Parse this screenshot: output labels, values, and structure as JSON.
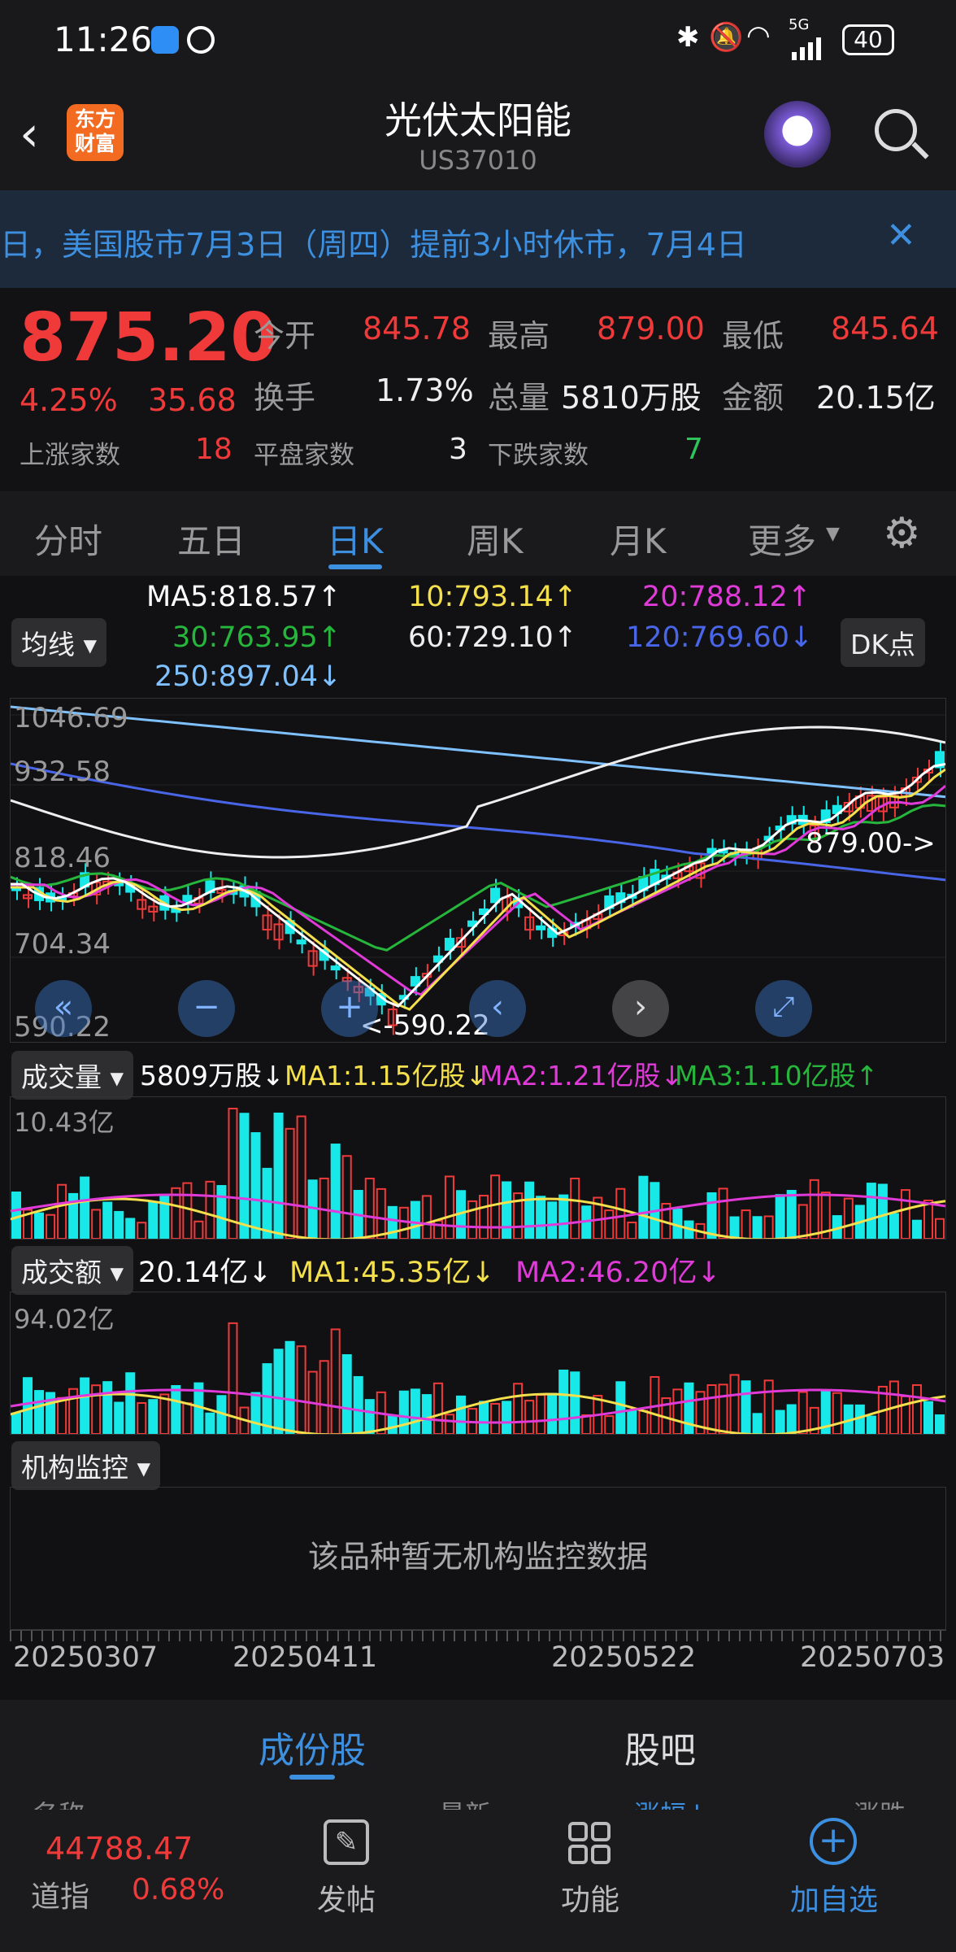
{
  "status": {
    "time": "11:26",
    "battery": "40",
    "net": "5G"
  },
  "header": {
    "title": "光伏太阳能",
    "code": "US37010",
    "logo": "东方财富",
    "logo_lines": [
      "东方",
      "财富"
    ]
  },
  "notice": {
    "text": "日，美国股市7月3日（周四）提前3小时休市，7月4日"
  },
  "quote": {
    "price": "875.20",
    "pct": "4.25%",
    "chg": "35.68",
    "open_label": "今开",
    "open": "845.78",
    "high_label": "最高",
    "high": "879.00",
    "low_label": "最低",
    "low": "845.64",
    "turnover_label": "换手",
    "turnover": "1.73%",
    "vol_label": "总量",
    "vol": "5810万股",
    "amt_label": "金额",
    "amt": "20.15亿",
    "up_label": "上涨家数",
    "up": "18",
    "flat_label": "平盘家数",
    "flat": "3",
    "down_label": "下跌家数",
    "down": "7"
  },
  "tabs": [
    "分时",
    "五日",
    "日K",
    "周K",
    "月K",
    "更多"
  ],
  "ma": {
    "btn": "均线",
    "ma5": "MA5:818.57↑",
    "ma10": "10:793.14↑",
    "ma20": "20:788.12↑",
    "ma30": "30:763.95↑",
    "ma60": "60:729.10↑",
    "ma120": "120:769.60↓",
    "ma250": "250:897.04↓",
    "dk": "DK点"
  },
  "price_axis": [
    "1046.69",
    "932.58",
    "818.46",
    "704.34",
    "590.22"
  ],
  "marks": {
    "high": "879.00->",
    "low": "<-590.22"
  },
  "volume": {
    "btn": "成交量",
    "val": "5809万股↓",
    "ma1": "MA1:1.15亿股↓",
    "ma2": "MA2:1.21亿股↓",
    "ma3": "MA3:1.10亿股↑",
    "axis": "10.43亿"
  },
  "amount": {
    "btn": "成交额",
    "val": "20.14亿↓",
    "ma1": "MA1:45.35亿↓",
    "ma2": "MA2:46.20亿↓",
    "axis": "94.02亿"
  },
  "inst": {
    "btn": "机构监控",
    "empty": "该品种暂无机构监控数据"
  },
  "dates": [
    "20250307",
    "20250411",
    "20250522",
    "20250703"
  ],
  "bottom_tabs": {
    "a": "成份股",
    "b": "股吧"
  },
  "list_header": {
    "name": "名称",
    "latest": "最新",
    "pct": "涨幅↓",
    "chg": "涨跌"
  },
  "footer": {
    "index_val": "44788.47",
    "index_name": "道指",
    "index_pct": "0.68%",
    "post": "发帖",
    "func": "功能",
    "add": "加自选"
  },
  "colors": {
    "up": "#f03a3a",
    "down": "#18e8e8",
    "accent": "#3d8fe0"
  }
}
